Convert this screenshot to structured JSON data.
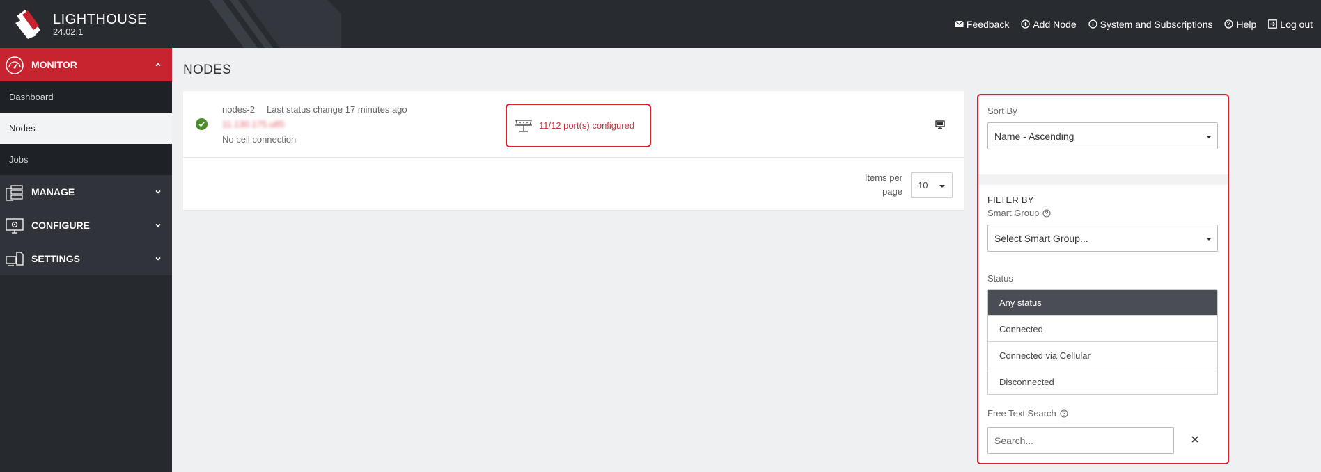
{
  "header": {
    "brand_name": "LIGHTHOUSE",
    "version": "24.02.1",
    "nav": [
      {
        "label": "Feedback",
        "icon": "envelope-icon"
      },
      {
        "label": "Add Node",
        "icon": "plus-circle-icon"
      },
      {
        "label": "System and Subscriptions",
        "icon": "info-circle-icon"
      },
      {
        "label": "Help",
        "icon": "question-circle-icon"
      },
      {
        "label": "Log out",
        "icon": "logout-icon"
      }
    ]
  },
  "sidebar": {
    "sections": [
      {
        "label": "MONITOR",
        "icon": "gauge-icon",
        "expanded": true,
        "items": [
          "Dashboard",
          "Nodes",
          "Jobs"
        ],
        "selected": "Nodes"
      },
      {
        "label": "MANAGE",
        "icon": "servers-icon",
        "expanded": false
      },
      {
        "label": "CONFIGURE",
        "icon": "monitor-gear-icon",
        "expanded": false
      },
      {
        "label": "SETTINGS",
        "icon": "devices-icon",
        "expanded": false
      }
    ]
  },
  "main": {
    "title": "NODES",
    "nodes": [
      {
        "name": "nodes-2",
        "status_change": "Last status change 17 minutes ago",
        "address": "11.130.175.u85",
        "cell": "No cell connection",
        "ports": "11/12 port(s) configured",
        "status_color": "#4c8c2b"
      }
    ],
    "pager": {
      "label_line1": "Items per",
      "label_line2": "page",
      "value": "10"
    }
  },
  "filter": {
    "sort_label": "Sort By",
    "sort_value": "Name - Ascending",
    "filter_heading": "FILTER BY",
    "smart_group_label": "Smart Group",
    "smart_group_value": "Select Smart Group...",
    "status_label": "Status",
    "status_options": [
      "Any status",
      "Connected",
      "Connected via Cellular",
      "Disconnected"
    ],
    "status_selected": "Any status",
    "search_label": "Free Text Search",
    "search_placeholder": "Search..."
  },
  "colors": {
    "accent": "#c72430",
    "highlight_border": "#d9202c",
    "topbar": "#282c31",
    "sidebar": "#262a2f"
  }
}
